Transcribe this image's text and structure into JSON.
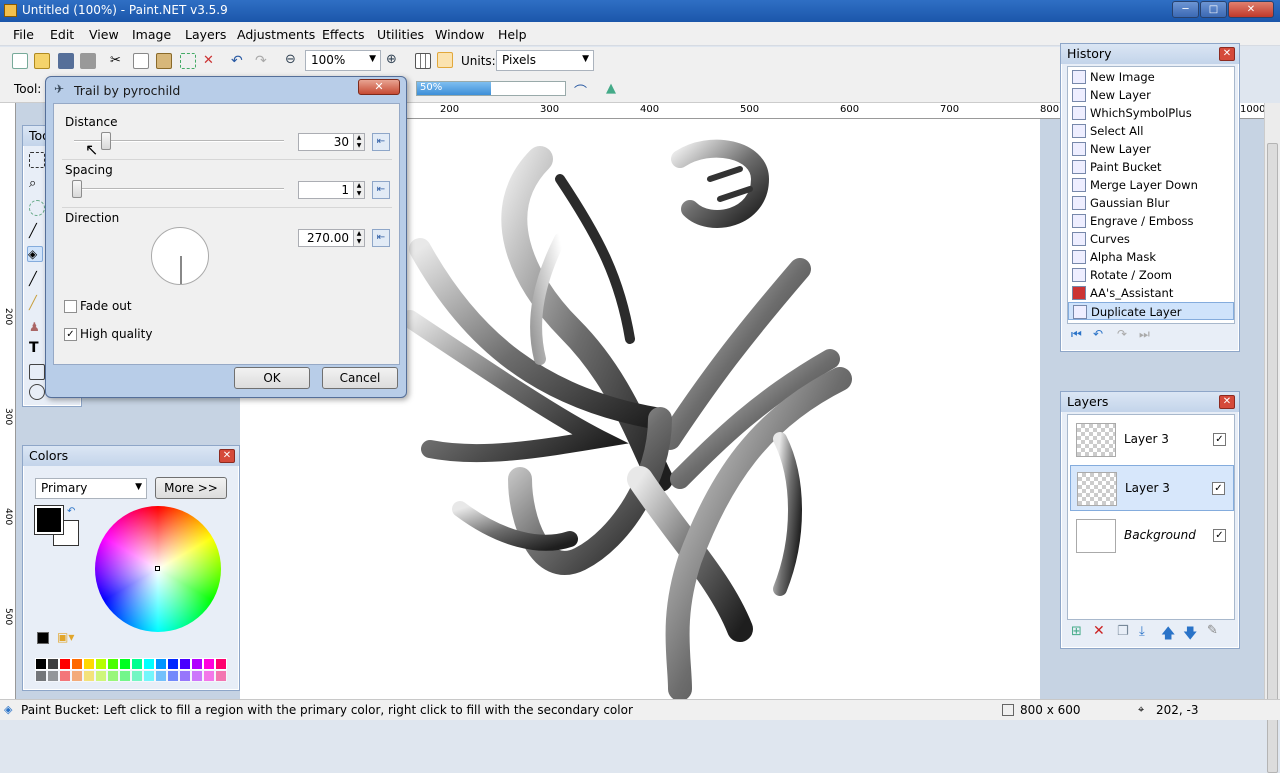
{
  "window": {
    "title": "Untitled (100%) - Paint.NET v3.5.9",
    "minimize": "─",
    "maximize": "□",
    "close": "✕"
  },
  "menu": [
    "File",
    "Edit",
    "View",
    "Image",
    "Layers",
    "Adjustments",
    "Effects",
    "Utilities",
    "Window",
    "Help"
  ],
  "toolbar": {
    "zoom": "100%",
    "units_label": "Units:",
    "units": "Pixels",
    "tool_label": "Tool:",
    "progress_text": "50%",
    "progress": 0.5
  },
  "ruler": {
    "marks": [
      "200",
      "300",
      "400",
      "500",
      "600",
      "700",
      "800",
      "1000"
    ],
    "left_marks": [
      "200",
      "300",
      "400",
      "500"
    ]
  },
  "dialog": {
    "title": "Trail by pyrochild",
    "distance_label": "Distance",
    "distance": "30",
    "distance_value": 30,
    "distance_max": 200,
    "spacing_label": "Spacing",
    "spacing": "1",
    "direction_label": "Direction",
    "direction": "270.00",
    "fade_out_label": "Fade out",
    "fade_out": false,
    "high_quality_label": "High quality",
    "high_quality": true,
    "ok": "OK",
    "cancel": "Cancel"
  },
  "tools_panel": {
    "title": "Too"
  },
  "history": {
    "title": "History",
    "items": [
      "New Image",
      "New Layer",
      "WhichSymbolPlus",
      "Select All",
      "New Layer",
      "Paint Bucket",
      "Merge Layer Down",
      "Gaussian Blur",
      "Engrave / Emboss",
      "Curves",
      "Alpha Mask",
      "Rotate / Zoom",
      "AA's_Assistant",
      "Duplicate Layer"
    ],
    "selected": "Duplicate Layer"
  },
  "layers": {
    "title": "Layers",
    "items": [
      {
        "name": "Layer 3",
        "visible": true
      },
      {
        "name": "Layer 3",
        "visible": true
      },
      {
        "name": "Background",
        "visible": true
      }
    ]
  },
  "colors": {
    "title": "Colors",
    "mode": "Primary",
    "more": "More >>",
    "primary": "#000000",
    "secondary": "#ffffff",
    "palette": [
      "#000000",
      "#404040",
      "#ff0000",
      "#ff6a00",
      "#ffd800",
      "#b6ff00",
      "#4cff00",
      "#00ff21",
      "#00ff90",
      "#00ffff",
      "#0094ff",
      "#0026ff",
      "#4800ff",
      "#b200ff",
      "#ff00dc",
      "#ff006e"
    ]
  },
  "status": {
    "hint": "Paint Bucket: Left click to fill a region with the primary color, right click to fill with the secondary color",
    "size": "800 x 600",
    "coords": "202, -3"
  }
}
